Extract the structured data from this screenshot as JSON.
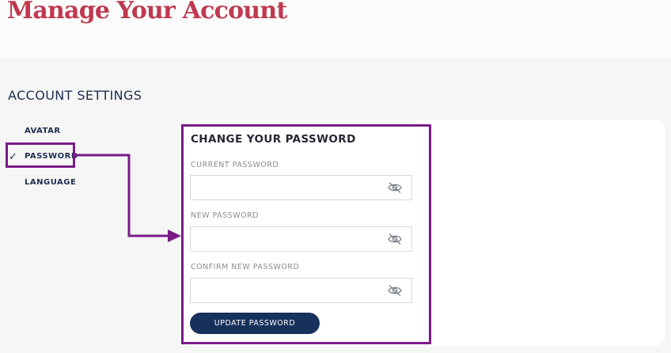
{
  "header": {
    "title": "Manage Your Account"
  },
  "section": {
    "title": "ACCOUNT SETTINGS"
  },
  "sidebar": {
    "items": [
      {
        "label": "AVATAR",
        "selected": false
      },
      {
        "label": "PASSWORD",
        "selected": true,
        "icon": "check-icon"
      },
      {
        "label": "LANGUAGE",
        "selected": false
      }
    ]
  },
  "form": {
    "title": "CHANGE YOUR PASSWORD",
    "fields": [
      {
        "label": "CURRENT PASSWORD",
        "value": "",
        "placeholder": "",
        "icon": "eye-slash-icon"
      },
      {
        "label": "NEW PASSWORD",
        "value": "",
        "placeholder": "",
        "icon": "eye-slash-icon"
      },
      {
        "label": "CONFIRM NEW PASSWORD",
        "value": "",
        "placeholder": "",
        "icon": "eye-slash-icon"
      }
    ],
    "submit_label": "UPDATE PASSWORD"
  },
  "colors": {
    "title": "#c0394f",
    "navy": "#1f2d4f",
    "button": "#17315c",
    "annotation": "#7a1b88"
  }
}
